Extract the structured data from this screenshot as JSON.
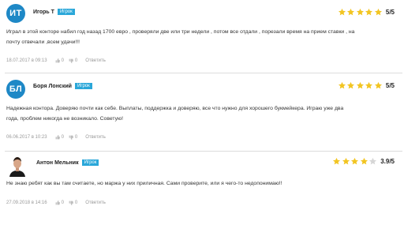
{
  "reviews": [
    {
      "avatar_initials": "ИТ",
      "author": "Игорь Т",
      "badge": "Игрок",
      "stars_filled": 5,
      "score": "5/5",
      "lines": [
        "Играл в этой конторе набил год назад 1700 евро , проверяли две или три недели , потом все отдали , порезали время на прием ставки , на",
        "почту отвечали ,всем удачи!!!"
      ],
      "date": "18.07.2017 в 09:13",
      "likes": "0",
      "dislikes": "0",
      "reply_label": "Ответить"
    },
    {
      "avatar_initials": "БЛ",
      "author": "Боря Лонский",
      "badge": "Игрок",
      "stars_filled": 5,
      "score": "5/5",
      "lines": [
        "Надежная контора. Доверяю почти как себе. Выплаты, поддержка и доверяю, все что нужно для хорошего букмейкера. Играю уже два",
        "года, проблем никогда не возникало. Советую!"
      ],
      "date": "06.06.2017 в 10:23",
      "likes": "0",
      "dislikes": "0",
      "reply_label": "Ответить"
    },
    {
      "avatar_initials": "",
      "author": "Антон Мельник",
      "badge": "Игрок",
      "stars_filled": 4,
      "score": "3.9/5",
      "lines": [
        "Не знаю ребят как вы там считаете, но маржа у них приличная. Сами проверите, или я чего-то недопонимаю!!"
      ],
      "date": "27.09.2018 в 14:16",
      "likes": "0",
      "dislikes": "0",
      "reply_label": "Ответить"
    }
  ],
  "colors": {
    "star": "#f2c522",
    "star_empty": "#d6d6d6",
    "avatar": "#1e88c6",
    "badge": "#2aa7d9"
  }
}
